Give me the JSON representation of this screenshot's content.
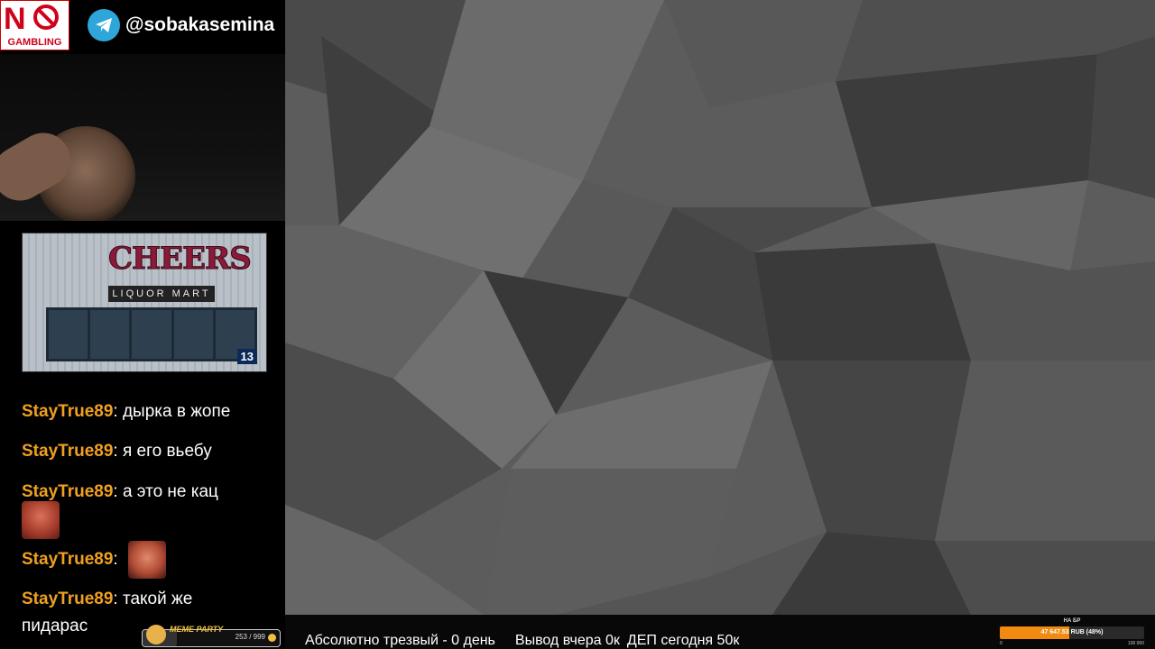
{
  "badge": {
    "top_text": "N",
    "bottom_text": "GAMBLING"
  },
  "telegram": {
    "handle": "@sobakasemina",
    "icon": "telegram-icon"
  },
  "news": {
    "sign_text": "CHEERS",
    "sign_subtext": "LIQUOR MART",
    "channel_logo": "13"
  },
  "chat": {
    "messages": [
      {
        "user": "StayTrue89",
        "text": ": дырка в жопе"
      },
      {
        "user": "StayTrue89",
        "text": ": я его вьебу"
      },
      {
        "user": "StayTrue89",
        "text": ": а это не кац",
        "emote": "crying-man-emote"
      },
      {
        "user": "StayTrue89",
        "text": ":",
        "emote": "laughing-man-emote"
      },
      {
        "user": "StayTrue89",
        "text": ": такой же",
        "continuation": "пидарас"
      }
    ]
  },
  "meme_party": {
    "title": "MEME PARTY",
    "count": "253 / 999",
    "progress": 0.253
  },
  "ticker": {
    "sober": "Абсолютно трезвый - 0 день",
    "withdraw": "Вывод вчера 0к",
    "deposit": "ДЕП сегодня 50к"
  },
  "goal": {
    "label": "НА БР",
    "amount": "47 647.53 RUB (48%)",
    "progress": 0.48,
    "min": "0",
    "max": "100 000"
  },
  "colors": {
    "username": "#f0a020",
    "goal_fill": "#f08a10",
    "telegram": "#2ea6da",
    "badge_red": "#d0021b"
  }
}
